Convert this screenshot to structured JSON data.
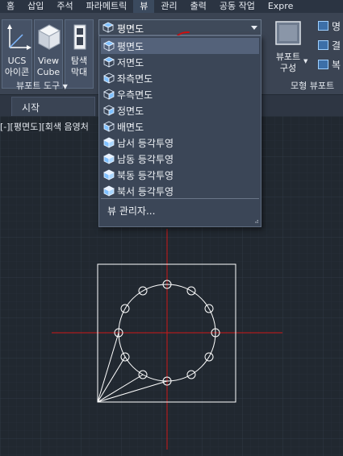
{
  "ribbon_tabs": [
    "홈",
    "삽입",
    "주석",
    "파라메트릭",
    "뷰",
    "관리",
    "출력",
    "공동 작업",
    "Expre"
  ],
  "active_tab": "뷰",
  "ribbon": {
    "ucs_label_1": "UCS",
    "ucs_label_2": "아이콘",
    "viewcube_label_1": "View",
    "viewcube_label_2": "Cube",
    "navbar_label_1": "탐색",
    "navbar_label_2": "막대",
    "viewport_tools_title": "뷰포트 도구",
    "viewport_config_label_1": "뷰포트",
    "viewport_config_label_2": "구성",
    "model_viewports_title": "모형 뷰포트",
    "right_item_1": "명",
    "right_item_2": "결",
    "right_item_3": "복"
  },
  "file_tab": "시작",
  "viewport_label": "[-][평면도][회색 음영처",
  "view_dropdown": {
    "current": "평면도",
    "items": [
      {
        "label": "평면도",
        "icon": "top-view-icon",
        "selected": true
      },
      {
        "label": "저면도",
        "icon": "bottom-view-icon",
        "selected": false
      },
      {
        "label": "좌측면도",
        "icon": "left-view-icon",
        "selected": false
      },
      {
        "label": "우측면도",
        "icon": "right-view-icon",
        "selected": false
      },
      {
        "label": "정면도",
        "icon": "front-view-icon",
        "selected": false
      },
      {
        "label": "배면도",
        "icon": "back-view-icon",
        "selected": false
      },
      {
        "label": "남서 등각투영",
        "icon": "sw-iso-icon",
        "selected": false
      },
      {
        "label": "남동 등각투영",
        "icon": "se-iso-icon",
        "selected": false
      },
      {
        "label": "북동 등각투영",
        "icon": "ne-iso-icon",
        "selected": false
      },
      {
        "label": "북서 등각투영",
        "icon": "nw-iso-icon",
        "selected": false
      }
    ],
    "manager_label": "뷰 관리자..."
  },
  "colors": {
    "canvas": "#212830",
    "grid": "#2c3540",
    "crosshair": "#d01818",
    "drawing": "#ffffff",
    "annotation": "#d01010"
  }
}
